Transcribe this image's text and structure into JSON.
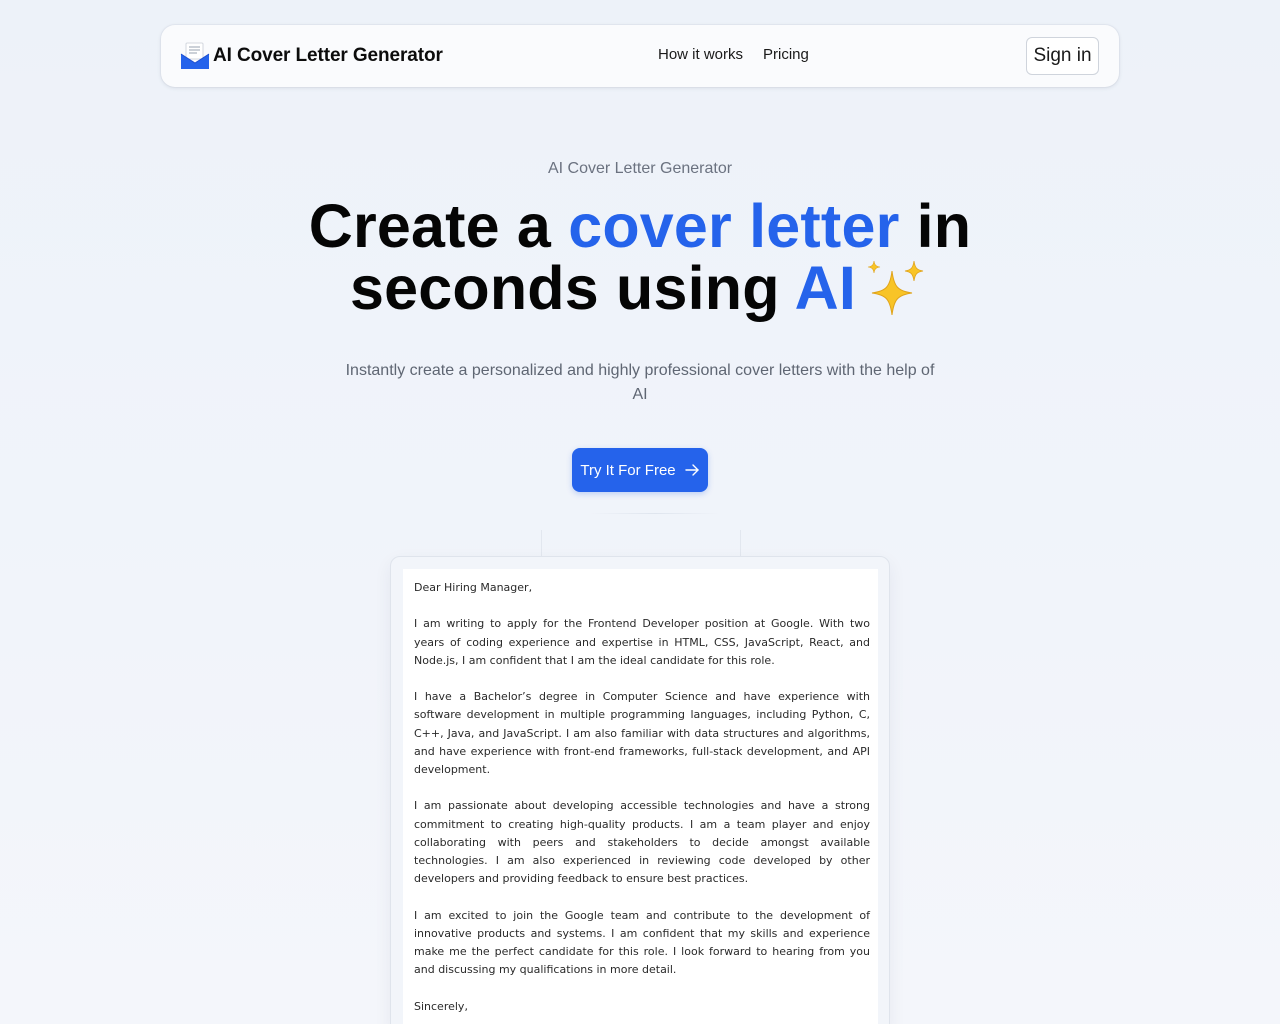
{
  "navbar": {
    "brand_name": "AI Cover Letter Generator",
    "links": [
      "How it works",
      "Pricing"
    ],
    "signin_label": "Sign in"
  },
  "hero": {
    "eyebrow": "AI Cover Letter Generator",
    "headline_part1": "Create a ",
    "headline_accent1": "cover letter",
    "headline_part2": " in",
    "headline_part3": "seconds using ",
    "headline_accent2": "AI",
    "subtitle": "Instantly create a personalized and highly professional cover letters with the help of AI",
    "cta_label": "Try It For Free"
  },
  "letter": {
    "greeting": "Dear Hiring Manager,",
    "paragraphs": [
      "I am writing to apply for the Frontend Developer position at Google. With two years of coding experience and expertise in HTML, CSS, JavaScript, React, and Node.js, I am confident that I am the ideal candidate for this role.",
      "I have a Bachelor’s degree in Computer Science and have experience with software development in multiple programming languages, including Python, C, C++, Java, and JavaScript. I am also familiar with data structures and algorithms, and have experience with front-end frameworks, full-stack development, and API development.",
      "I am passionate about developing accessible technologies and have a strong commitment to creating high-quality products. I am a team player and enjoy collaborating with peers and stakeholders to decide amongst available technologies. I am also experienced in reviewing code developed by other developers and providing feedback to ensure best practices.",
      "I am excited to join the Google team and contribute to the development of innovative products and systems. I am confident that my skills and experience make me the perfect candidate for this role. I look forward to hearing from you and discussing my qualifications in more detail."
    ],
    "closing": "Sincerely,"
  },
  "colors": {
    "accent": "#2563eb",
    "background": "#eef2f9",
    "headline": "#050505",
    "muted_text": "#6b7280"
  },
  "icons": {
    "brand": "envelope-letter-icon",
    "headline_emoji": "sparkles-icon",
    "cta": "arrow-right-icon"
  }
}
